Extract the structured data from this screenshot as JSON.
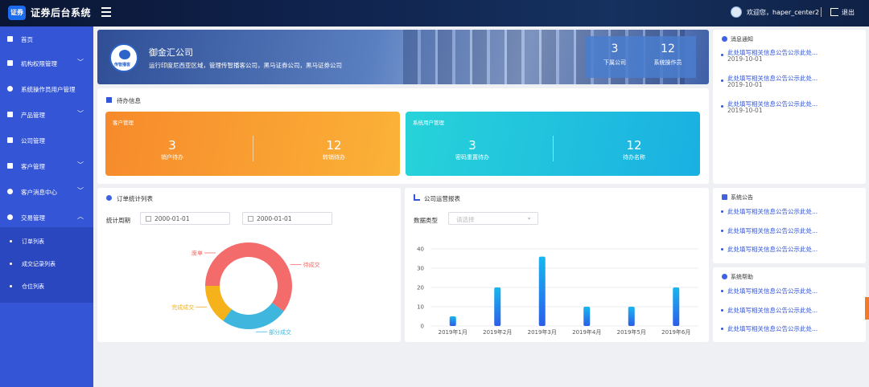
{
  "topbar": {
    "logo_text": "证券",
    "brand": "证券后台系统",
    "welcome": "欢迎您，haper_center2",
    "logout": "退出"
  },
  "sidebar": {
    "items": [
      {
        "label": "首页",
        "icon": "home-icon",
        "chevron": ""
      },
      {
        "label": "机构权限管理",
        "icon": "document-icon",
        "chevron": "﹀"
      },
      {
        "label": "系统操作员用户管理",
        "icon": "user-icon",
        "chevron": ""
      },
      {
        "label": "产品管理",
        "icon": "cube-icon",
        "chevron": "﹀"
      },
      {
        "label": "公司管理",
        "icon": "briefcase-icon",
        "chevron": ""
      },
      {
        "label": "客户管理",
        "icon": "customer-icon",
        "chevron": "﹀"
      },
      {
        "label": "客户消息中心",
        "icon": "message-icon",
        "chevron": "﹀"
      },
      {
        "label": "交易管理",
        "icon": "trade-icon",
        "chevron": "︿"
      }
    ],
    "subitems": [
      "订单列表",
      "成交记录列表",
      "仓位列表"
    ]
  },
  "hero": {
    "logo_text": "传智播客",
    "company_name": "御金汇公司",
    "company_desc": "运行印度尼西亚区域，管理传智播客公司，黑马证券公司，黑马证券公司",
    "stats": [
      {
        "value": "3",
        "label": "下属公司"
      },
      {
        "value": "12",
        "label": "系统操作员"
      }
    ]
  },
  "todo": {
    "title": "待办信息",
    "cards": [
      {
        "title": "客户管理",
        "items": [
          {
            "value": "3",
            "label": "销户待办"
          },
          {
            "value": "12",
            "label": "转销待办"
          }
        ]
      },
      {
        "title": "系统用户管理",
        "items": [
          {
            "value": "3",
            "label": "密码重置待办"
          },
          {
            "value": "12",
            "label": "待办名称"
          }
        ]
      }
    ]
  },
  "notices": {
    "title": "消息通知",
    "items": [
      {
        "text": "此处填写相关信息公告公示此处...",
        "date": "2019-10-01"
      },
      {
        "text": "此处填写相关信息公告公示此处...",
        "date": "2019-10-01"
      },
      {
        "text": "此处填写相关信息公告公示此处...",
        "date": "2019-10-01"
      }
    ]
  },
  "announcements": {
    "title": "系统公告",
    "items": [
      "此处填写相关信息公告公示此处...",
      "此处填写相关信息公告公示此处...",
      "此处填写相关信息公告公示此处..."
    ]
  },
  "help": {
    "title": "系统帮助",
    "items": [
      "此处填写相关信息公告公示此处...",
      "此处填写相关信息公告公示此处...",
      "此处填写相关信息公告公示此处..."
    ]
  },
  "orders": {
    "title": "订单统计列表",
    "period_label": "统计周期",
    "start_date": "2000-01-01",
    "end_date": "2000-01-01"
  },
  "report": {
    "title": "公司运营报表",
    "data_type_label": "数据类型",
    "data_type_placeholder": "请选择"
  },
  "chart_data": [
    {
      "type": "pie",
      "variant": "donut",
      "categories": [
        "待成交",
        "部分成交",
        "完成成交",
        "废单"
      ],
      "values": [
        35,
        25,
        15,
        25
      ],
      "colors": [
        "#f46b6b",
        "#3eb6dd",
        "#f5b21a",
        "#f46b6b"
      ]
    },
    {
      "type": "bar",
      "categories": [
        "2019年1月",
        "2019年2月",
        "2019年3月",
        "2019年4月",
        "2019年5月",
        "2019年6月"
      ],
      "values": [
        5,
        20,
        36,
        10,
        10,
        20
      ],
      "ylim": [
        0,
        40
      ],
      "yticks": [
        0,
        10,
        20,
        30,
        40
      ],
      "grid": true,
      "colors": [
        "#18b7f0",
        "#2b5ee8"
      ]
    }
  ]
}
